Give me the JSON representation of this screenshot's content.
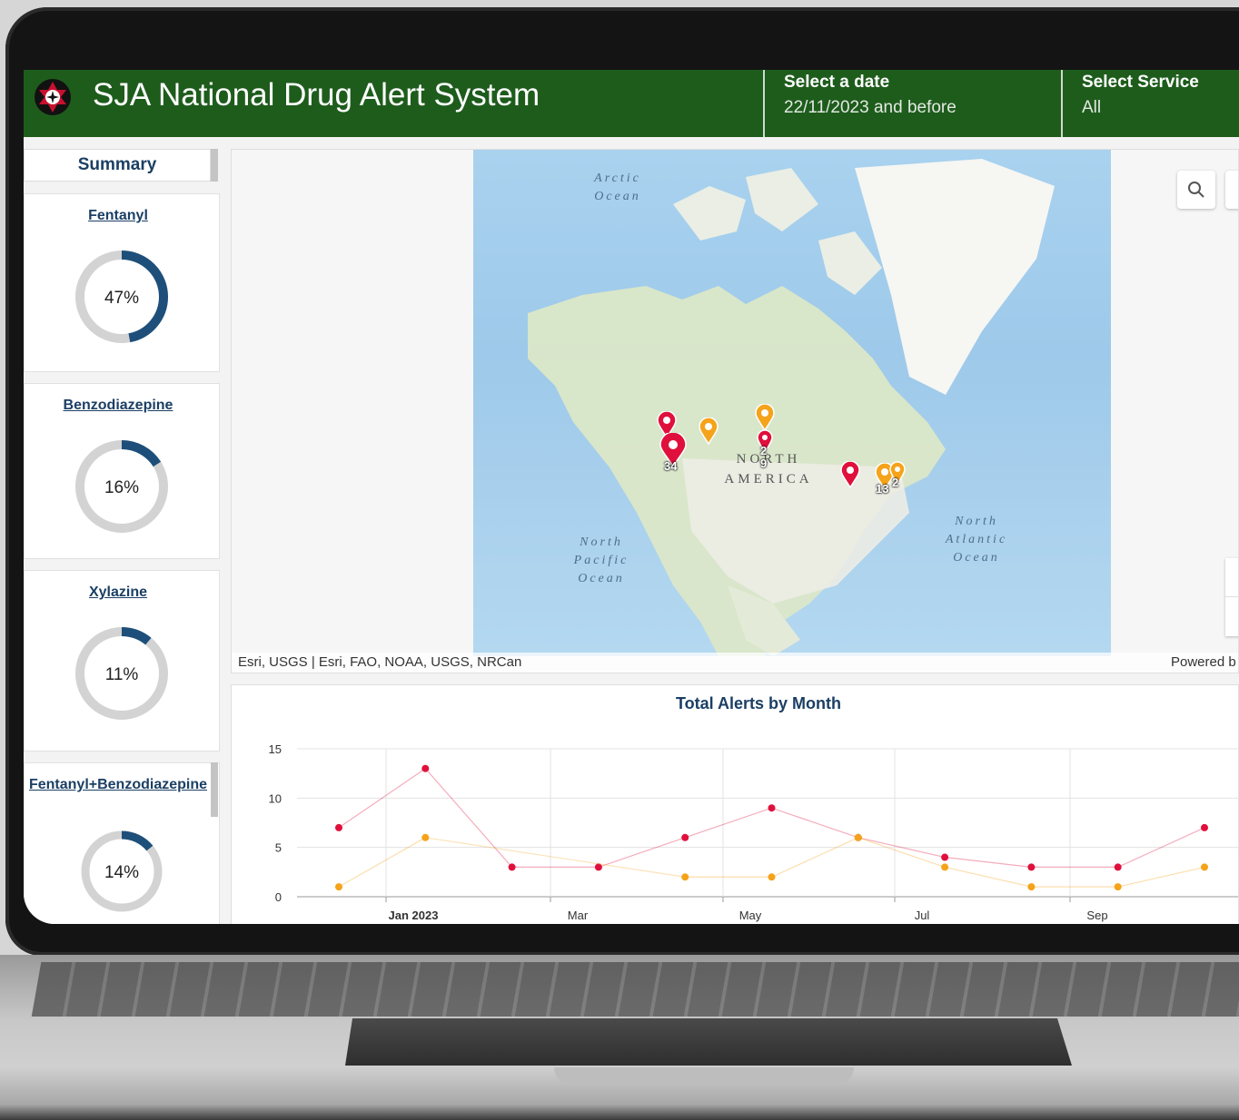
{
  "header": {
    "title": "SJA National Drug Alert System",
    "date_filter": {
      "title": "Select a date",
      "value": "22/11/2023 and before"
    },
    "service_filter": {
      "title": "Select Service",
      "value": "All"
    }
  },
  "summary": {
    "tab_label": "Summary",
    "cards": [
      {
        "label": "Fentanyl",
        "percent": 47,
        "percent_label": "47%"
      },
      {
        "label": "Benzodiazepine",
        "percent": 16,
        "percent_label": "16%"
      },
      {
        "label": "Xylazine",
        "percent": 11,
        "percent_label": "11%"
      },
      {
        "label": "Fentanyl+Benzodiazepine",
        "percent": 14,
        "percent_label": "14%"
      }
    ]
  },
  "map": {
    "labels": {
      "arctic": "Arctic Ocean",
      "pacific": "North Pacific Ocean",
      "atlantic": "North Atlantic Ocean",
      "north_america": "NORTH AMERICA"
    },
    "cluster_counts": [
      "34",
      "2",
      "9",
      "13",
      "2"
    ],
    "attribution_left": "Esri, USGS | Esri, FAO, NOAA, USGS, NRCan",
    "attribution_right": "Powered b"
  },
  "colors": {
    "header_green": "#1e5c1c",
    "donut_fill": "#1d4f7a",
    "donut_track": "#d3d3d3",
    "series_red": "#e0103c",
    "series_orange": "#f5a31a"
  },
  "chart_data": {
    "type": "line",
    "title": "Total Alerts by Month",
    "x": [
      "2022-12",
      "2023-01",
      "2023-02",
      "2023-03",
      "2023-04",
      "2023-05",
      "2023-06",
      "2023-07",
      "2023-08",
      "2023-09",
      "2023-10"
    ],
    "x_tick_labels": [
      "Jan 2023",
      "Mar",
      "May",
      "Jul",
      "Sep"
    ],
    "series": [
      {
        "color": "#e0103c",
        "values": [
          7,
          13,
          3,
          3,
          6,
          9,
          6,
          4,
          3,
          3,
          7
        ]
      },
      {
        "color": "#f5a31a",
        "values": [
          1,
          6,
          null,
          null,
          2,
          2,
          6,
          3,
          1,
          1,
          3
        ]
      }
    ],
    "ylim": [
      0,
      15
    ],
    "yticks": [
      0,
      5,
      10,
      15
    ],
    "grid": true
  }
}
